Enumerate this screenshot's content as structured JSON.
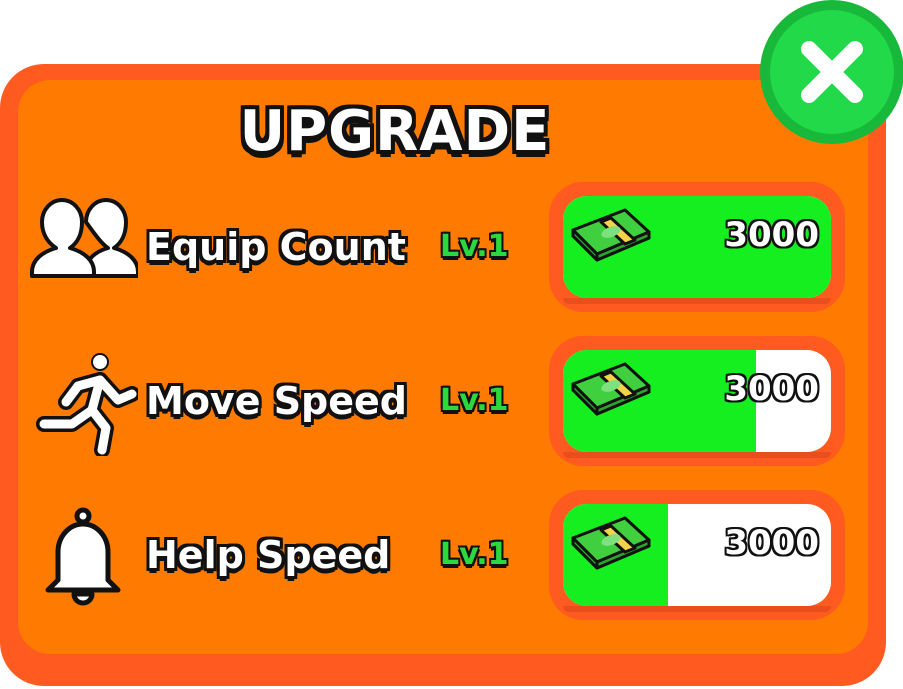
{
  "title": "UPGRADE",
  "colors": {
    "panel_border": "#ff5a1f",
    "panel_fill": "#ff7a00",
    "progress_fill": "#15ee1f",
    "level_text": "#2bd93f",
    "close_button": "#22d94a"
  },
  "close_button": {
    "icon": "close-x-icon"
  },
  "upgrades": [
    {
      "icon": "two-users-icon",
      "label": "Equip Count",
      "level": "Lv.1",
      "price": "3000",
      "currency_icon": "cash-stack-icon",
      "progress": 1.0
    },
    {
      "icon": "running-person-icon",
      "label": "Move Speed",
      "level": "Lv.1",
      "price": "3000",
      "currency_icon": "cash-stack-icon",
      "progress": 0.72
    },
    {
      "icon": "bell-icon",
      "label": "Help Speed",
      "level": "Lv.1",
      "price": "3000",
      "currency_icon": "cash-stack-icon",
      "progress": 0.39
    }
  ]
}
